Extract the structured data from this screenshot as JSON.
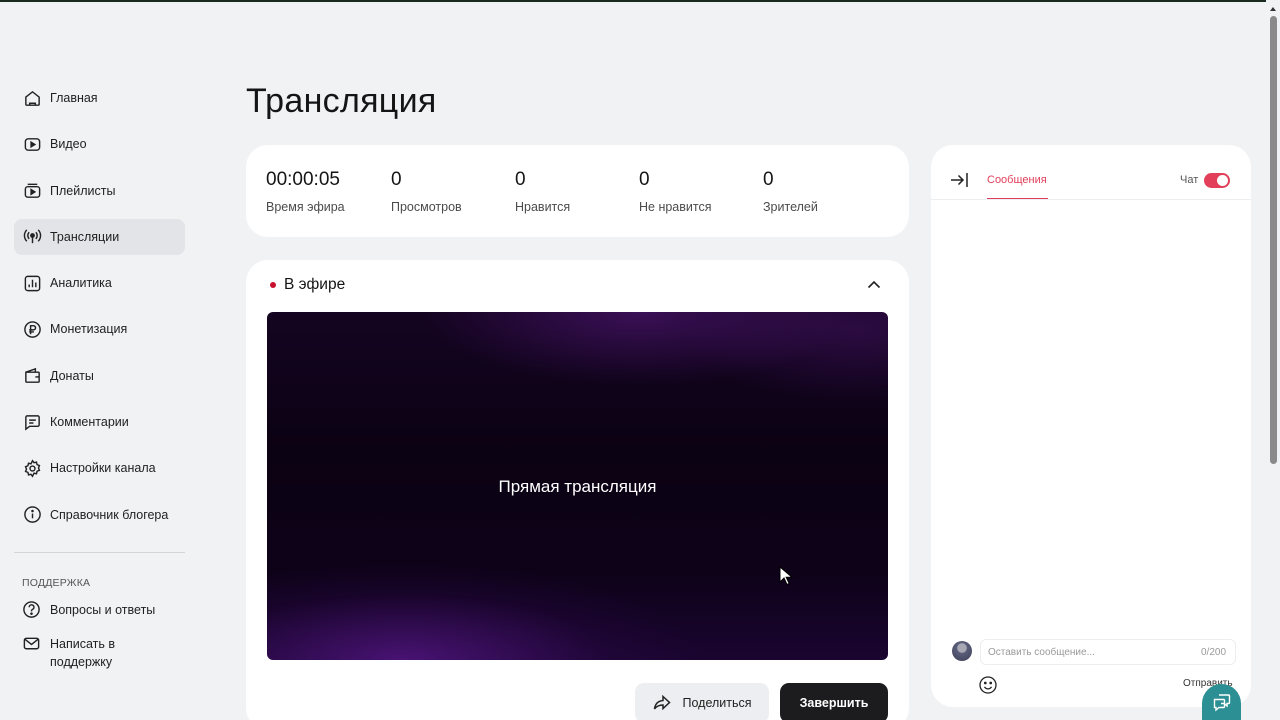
{
  "sidebar": {
    "items": [
      {
        "label": "Главная",
        "icon": "home-icon"
      },
      {
        "label": "Видео",
        "icon": "video-icon"
      },
      {
        "label": "Плейлисты",
        "icon": "playlist-icon"
      },
      {
        "label": "Трансляции",
        "icon": "broadcast-icon",
        "active": true
      },
      {
        "label": "Аналитика",
        "icon": "analytics-icon"
      },
      {
        "label": "Монетизация",
        "icon": "ruble-icon"
      },
      {
        "label": "Донаты",
        "icon": "wallet-icon"
      },
      {
        "label": "Комментарии",
        "icon": "comment-icon"
      },
      {
        "label": "Настройки канала",
        "icon": "gear-icon"
      },
      {
        "label": "Справочник блогера",
        "icon": "info-icon"
      }
    ],
    "support_title": "ПОДДЕРЖКА",
    "support_items": [
      {
        "label": "Вопросы и ответы",
        "icon": "question-icon"
      },
      {
        "label": "Написать в\nподдержку",
        "icon": "mail-icon"
      }
    ]
  },
  "page": {
    "title": "Трансляция"
  },
  "stats": [
    {
      "value": "00:00:05",
      "label": "Время эфира"
    },
    {
      "value": "0",
      "label": "Просмотров"
    },
    {
      "value": "0",
      "label": "Нравится"
    },
    {
      "value": "0",
      "label": "Не нравится"
    },
    {
      "value": "0",
      "label": "Зрителей"
    }
  ],
  "live": {
    "status_label": "В эфире",
    "player_title": "Прямая трансляция",
    "share_label": "Поделиться",
    "end_label": "Завершить"
  },
  "chat": {
    "tab_label": "Сообщения",
    "toggle_label": "Чат",
    "toggle_on": true,
    "input_placeholder": "Оставить сообщение...",
    "char_count": "0/200",
    "send_label": "Отправить"
  },
  "colors": {
    "accent": "#e2405a",
    "live_dot": "#c8102e",
    "primary_button": "#1c1c1e",
    "support_fab": "#2c8f93"
  }
}
